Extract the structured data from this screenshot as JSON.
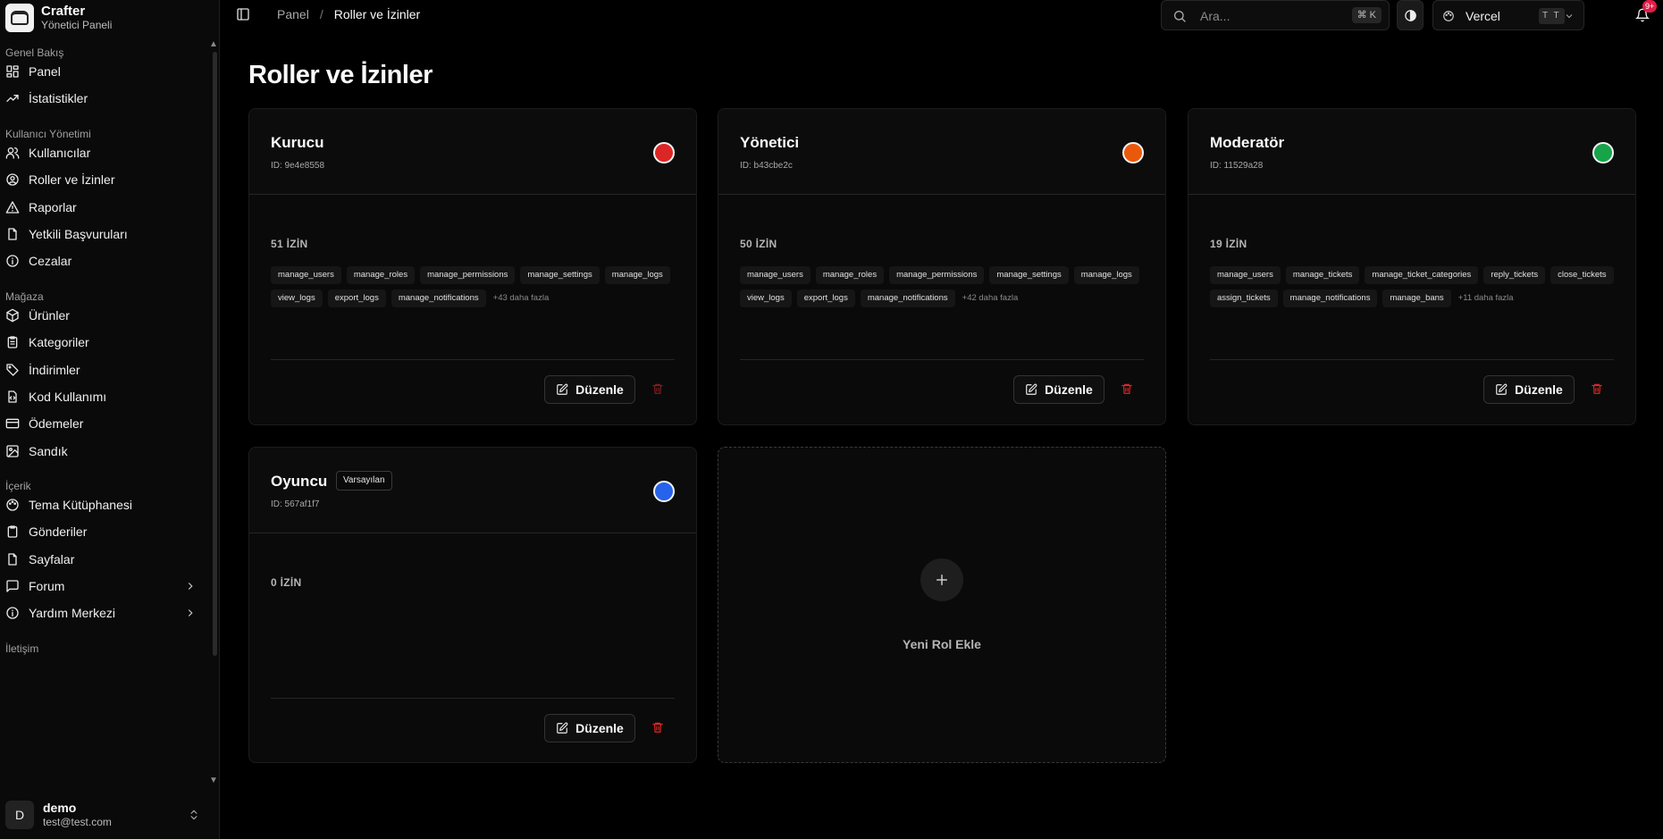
{
  "brand": {
    "name": "Crafter",
    "subtitle": "Yönetici Paneli"
  },
  "sidebar": {
    "sections": [
      {
        "title": "Genel Bakış",
        "items": [
          {
            "label": "Panel",
            "icon": "dashboard-icon"
          },
          {
            "label": "İstatistikler",
            "icon": "trending-up-icon"
          }
        ]
      },
      {
        "title": "Kullanıcı Yönetimi",
        "items": [
          {
            "label": "Kullanıcılar",
            "icon": "users-icon"
          },
          {
            "label": "Roller ve İzinler",
            "icon": "user-circle-icon"
          },
          {
            "label": "Raporlar",
            "icon": "alert-triangle-icon"
          },
          {
            "label": "Yetkili Başvuruları",
            "icon": "file-icon"
          },
          {
            "label": "Cezalar",
            "icon": "info-circle-icon"
          }
        ]
      },
      {
        "title": "Mağaza",
        "items": [
          {
            "label": "Ürünler",
            "icon": "box-icon"
          },
          {
            "label": "Kategoriler",
            "icon": "clipboard-list-icon"
          },
          {
            "label": "İndirimler",
            "icon": "tag-icon"
          },
          {
            "label": "Kod Kullanımı",
            "icon": "file-code-icon"
          },
          {
            "label": "Ödemeler",
            "icon": "credit-card-icon"
          },
          {
            "label": "Sandık",
            "icon": "image-icon"
          }
        ]
      },
      {
        "title": "İçerik",
        "items": [
          {
            "label": "Tema Kütüphanesi",
            "icon": "palette-icon"
          },
          {
            "label": "Gönderiler",
            "icon": "clipboard-icon"
          },
          {
            "label": "Sayfalar",
            "icon": "file-icon"
          },
          {
            "label": "Forum",
            "icon": "message-square-icon",
            "expandable": true
          },
          {
            "label": "Yardım Merkezi",
            "icon": "info-circle-icon",
            "expandable": true
          }
        ]
      },
      {
        "title": "İletişim",
        "items": []
      }
    ]
  },
  "user": {
    "initial": "D",
    "name": "demo",
    "email": "test@test.com"
  },
  "topbar": {
    "breadcrumb": {
      "parent": "Panel",
      "separator": "/",
      "current": "Roller ve İzinler"
    },
    "search": {
      "placeholder": "Ara...",
      "shortcut": "⌘ K"
    },
    "theme_select": {
      "label": "Vercel",
      "badge": "T T"
    },
    "notifications": {
      "count": "9+"
    }
  },
  "page": {
    "title": "Roller ve İzinler"
  },
  "roles": [
    {
      "name": "Kurucu",
      "id": "ID: 9e4e8558",
      "color": "#dc2626",
      "permission_count": "51 İZİN",
      "permissions": [
        "manage_users",
        "manage_roles",
        "manage_permissions",
        "manage_settings",
        "manage_logs",
        "view_logs",
        "export_logs",
        "manage_notifications"
      ],
      "more": "+43 daha fazla",
      "default_badge": ""
    },
    {
      "name": "Yönetici",
      "id": "ID: b43cbe2c",
      "color": "#ea580c",
      "permission_count": "50 İZİN",
      "permissions": [
        "manage_users",
        "manage_roles",
        "manage_permissions",
        "manage_settings",
        "manage_logs",
        "view_logs",
        "export_logs",
        "manage_notifications"
      ],
      "more": "+42 daha fazla",
      "default_badge": ""
    },
    {
      "name": "Moderatör",
      "id": "ID: 11529a28",
      "color": "#16a34a",
      "permission_count": "19 İZİN",
      "permissions": [
        "manage_users",
        "manage_tickets",
        "manage_ticket_categories",
        "reply_tickets",
        "close_tickets",
        "assign_tickets",
        "manage_notifications",
        "manage_bans"
      ],
      "more": "+11 daha fazla",
      "default_badge": ""
    },
    {
      "name": "Oyuncu",
      "id": "ID: 567af1f7",
      "color": "#2563eb",
      "permission_count": "0 İZİN",
      "permissions": [],
      "more": "",
      "default_badge": "Varsayılan"
    }
  ],
  "actions": {
    "edit_label": "Düzenle",
    "add_role_label": "Yeni Rol Ekle"
  },
  "colors": {
    "background": "#000000",
    "card": "#0a0a0a",
    "danger": "#dc2626"
  }
}
